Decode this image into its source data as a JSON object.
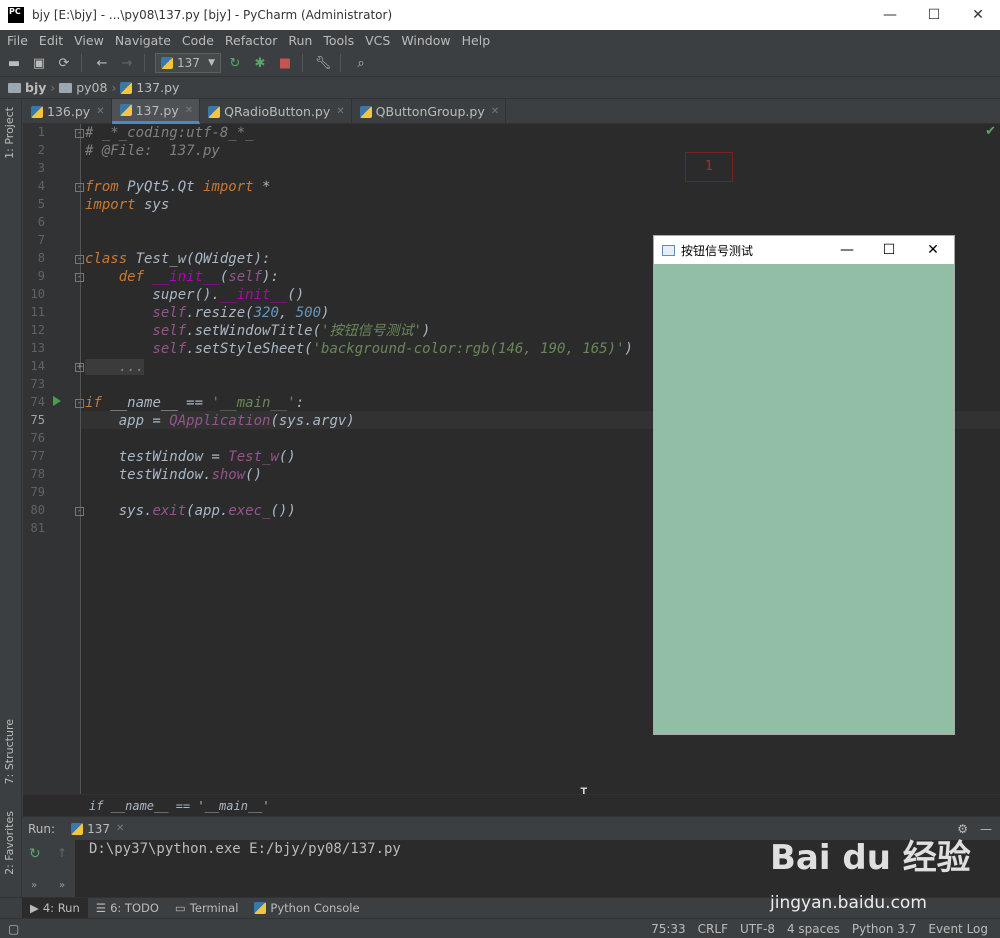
{
  "window": {
    "title": "bjy [E:\\bjy] - ...\\py08\\137.py [bjy] - PyCharm (Administrator)",
    "logo": "PC"
  },
  "menu": [
    "File",
    "Edit",
    "View",
    "Navigate",
    "Code",
    "Refactor",
    "Run",
    "Tools",
    "VCS",
    "Window",
    "Help"
  ],
  "toolbar": {
    "run_config": "137"
  },
  "nav": {
    "project": "bjy",
    "folder": "py08",
    "file": "137.py"
  },
  "sidebar": {
    "project": "1: Project",
    "structure": "7: Structure",
    "favorites": "2: Favorites"
  },
  "tabs": [
    {
      "label": "136.py"
    },
    {
      "label": "137.py",
      "active": true
    },
    {
      "label": "QRadioButton.py"
    },
    {
      "label": "QButtonGroup.py"
    }
  ],
  "editor": {
    "line_numbers": [
      "1",
      "2",
      "3",
      "4",
      "5",
      "6",
      "7",
      "8",
      "9",
      "10",
      "11",
      "12",
      "13",
      "14",
      "73",
      "74",
      "75",
      "76",
      "77",
      "78",
      "79",
      "80",
      "81"
    ],
    "current_line": "75",
    "lines": {
      "l1": "# _*_coding:utf-8_*_",
      "l2": "# @File:  137.py",
      "l4a": "from",
      "l4b": " PyQt5.Qt ",
      "l4c": "import",
      "l4d": " *",
      "l5a": "import",
      "l5b": " sys",
      "l8a": "class ",
      "l8b": "Test_w",
      "l8c": "(QWidget):",
      "l9a": "    def ",
      "l9b": "__init__",
      "l9c": "(",
      "l9d": "self",
      "l9e": "):",
      "l10a": "        super().",
      "l10b": "__init__",
      "l10c": "()",
      "l11a": "        self",
      "l11b": ".resize(",
      "l11c": "320",
      "l11d": ", ",
      "l11e": "500",
      "l11f": ")",
      "l12a": "        self",
      "l12b": ".setWindowTitle(",
      "l12c": "'按钮信号测试'",
      "l12d": ")",
      "l13a": "        self",
      "l13b": ".setStyleSheet(",
      "l13c": "'background-color:rgb(146, 190, 165)'",
      "l13d": ")",
      "l14": "    ...",
      "l74a": "if ",
      "l74b": "__name__ == ",
      "l74c": "'__main__'",
      "l74d": ":",
      "l75a": "    app = ",
      "l75b": "QApplication",
      "l75c": "(sys.argv)",
      "l77a": "    testWindow = ",
      "l77b": "Test_w",
      "l77c": "()",
      "l78a": "    testWindow.",
      "l78b": "show",
      "l78c": "()",
      "l80a": "    sys.",
      "l80b": "exit",
      "l80c": "(app.",
      "l80d": "exec_",
      "l80e": "())"
    },
    "annotation": "1",
    "breadcrumb": "if __name__ == '__main__'"
  },
  "qt_window": {
    "title": "按钮信号测试",
    "bg": "#92bea5"
  },
  "run": {
    "label": "Run:",
    "tab": "137",
    "output": "D:\\py37\\python.exe E:/bjy/py08/137.py"
  },
  "bottom_tabs": [
    "4: Run",
    "6: TODO",
    "Terminal",
    "Python Console"
  ],
  "status": {
    "position": "75:33",
    "line_sep": "CRLF",
    "encoding": "UTF-8",
    "indent": "4 spaces",
    "interpreter": "Python 3.7",
    "event_log": "Event Log"
  },
  "watermark": {
    "brand": "Bai du 经验",
    "url": "jingyan.baidu.com"
  }
}
